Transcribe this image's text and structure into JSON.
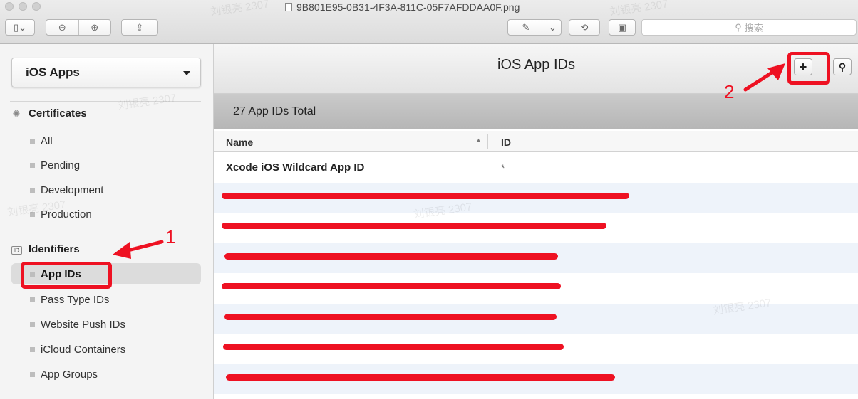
{
  "window": {
    "title": "9B801E95-0B31-4F3A-811C-05F7AFDDAA0F.png",
    "search_placeholder": "搜索",
    "icons": [
      "sidebar-toggle-icon",
      "zoom-out-icon",
      "zoom-in-icon",
      "share-icon",
      "markup-icon",
      "rotate-icon",
      "toolbox-icon",
      "search-icon"
    ]
  },
  "sidebar": {
    "platform_select": "iOS Apps",
    "sections": [
      {
        "title": "Certificates",
        "icon": "certificate-icon",
        "items": [
          "All",
          "Pending",
          "Development",
          "Production"
        ]
      },
      {
        "title": "Identifiers",
        "icon": "id-badge-icon",
        "icon_text": "ID",
        "items": [
          "App IDs",
          "Pass Type IDs",
          "Website Push IDs",
          "iCloud Containers",
          "App Groups"
        ],
        "active": "App IDs"
      }
    ]
  },
  "main": {
    "title": "iOS App IDs",
    "add_label": "+",
    "total_label": "27 App IDs Total",
    "columns": {
      "name": "Name",
      "id": "ID"
    },
    "rows": [
      {
        "name": "Xcode iOS Wildcard App ID",
        "id": "*",
        "redacted": false
      },
      {
        "name": "",
        "id": "",
        "redacted": true
      },
      {
        "name": "",
        "id": "",
        "redacted": true
      },
      {
        "name": "",
        "id": "",
        "redacted": true
      },
      {
        "name": "",
        "id": "",
        "redacted": true
      },
      {
        "name": "",
        "id": "",
        "redacted": true
      },
      {
        "name": "",
        "id": "",
        "redacted": true
      },
      {
        "name": "",
        "id": "",
        "redacted": true
      }
    ]
  },
  "annotations": {
    "step1": "1",
    "step2": "2",
    "color": "#ee1122"
  },
  "watermark": "刘银亮 2307"
}
